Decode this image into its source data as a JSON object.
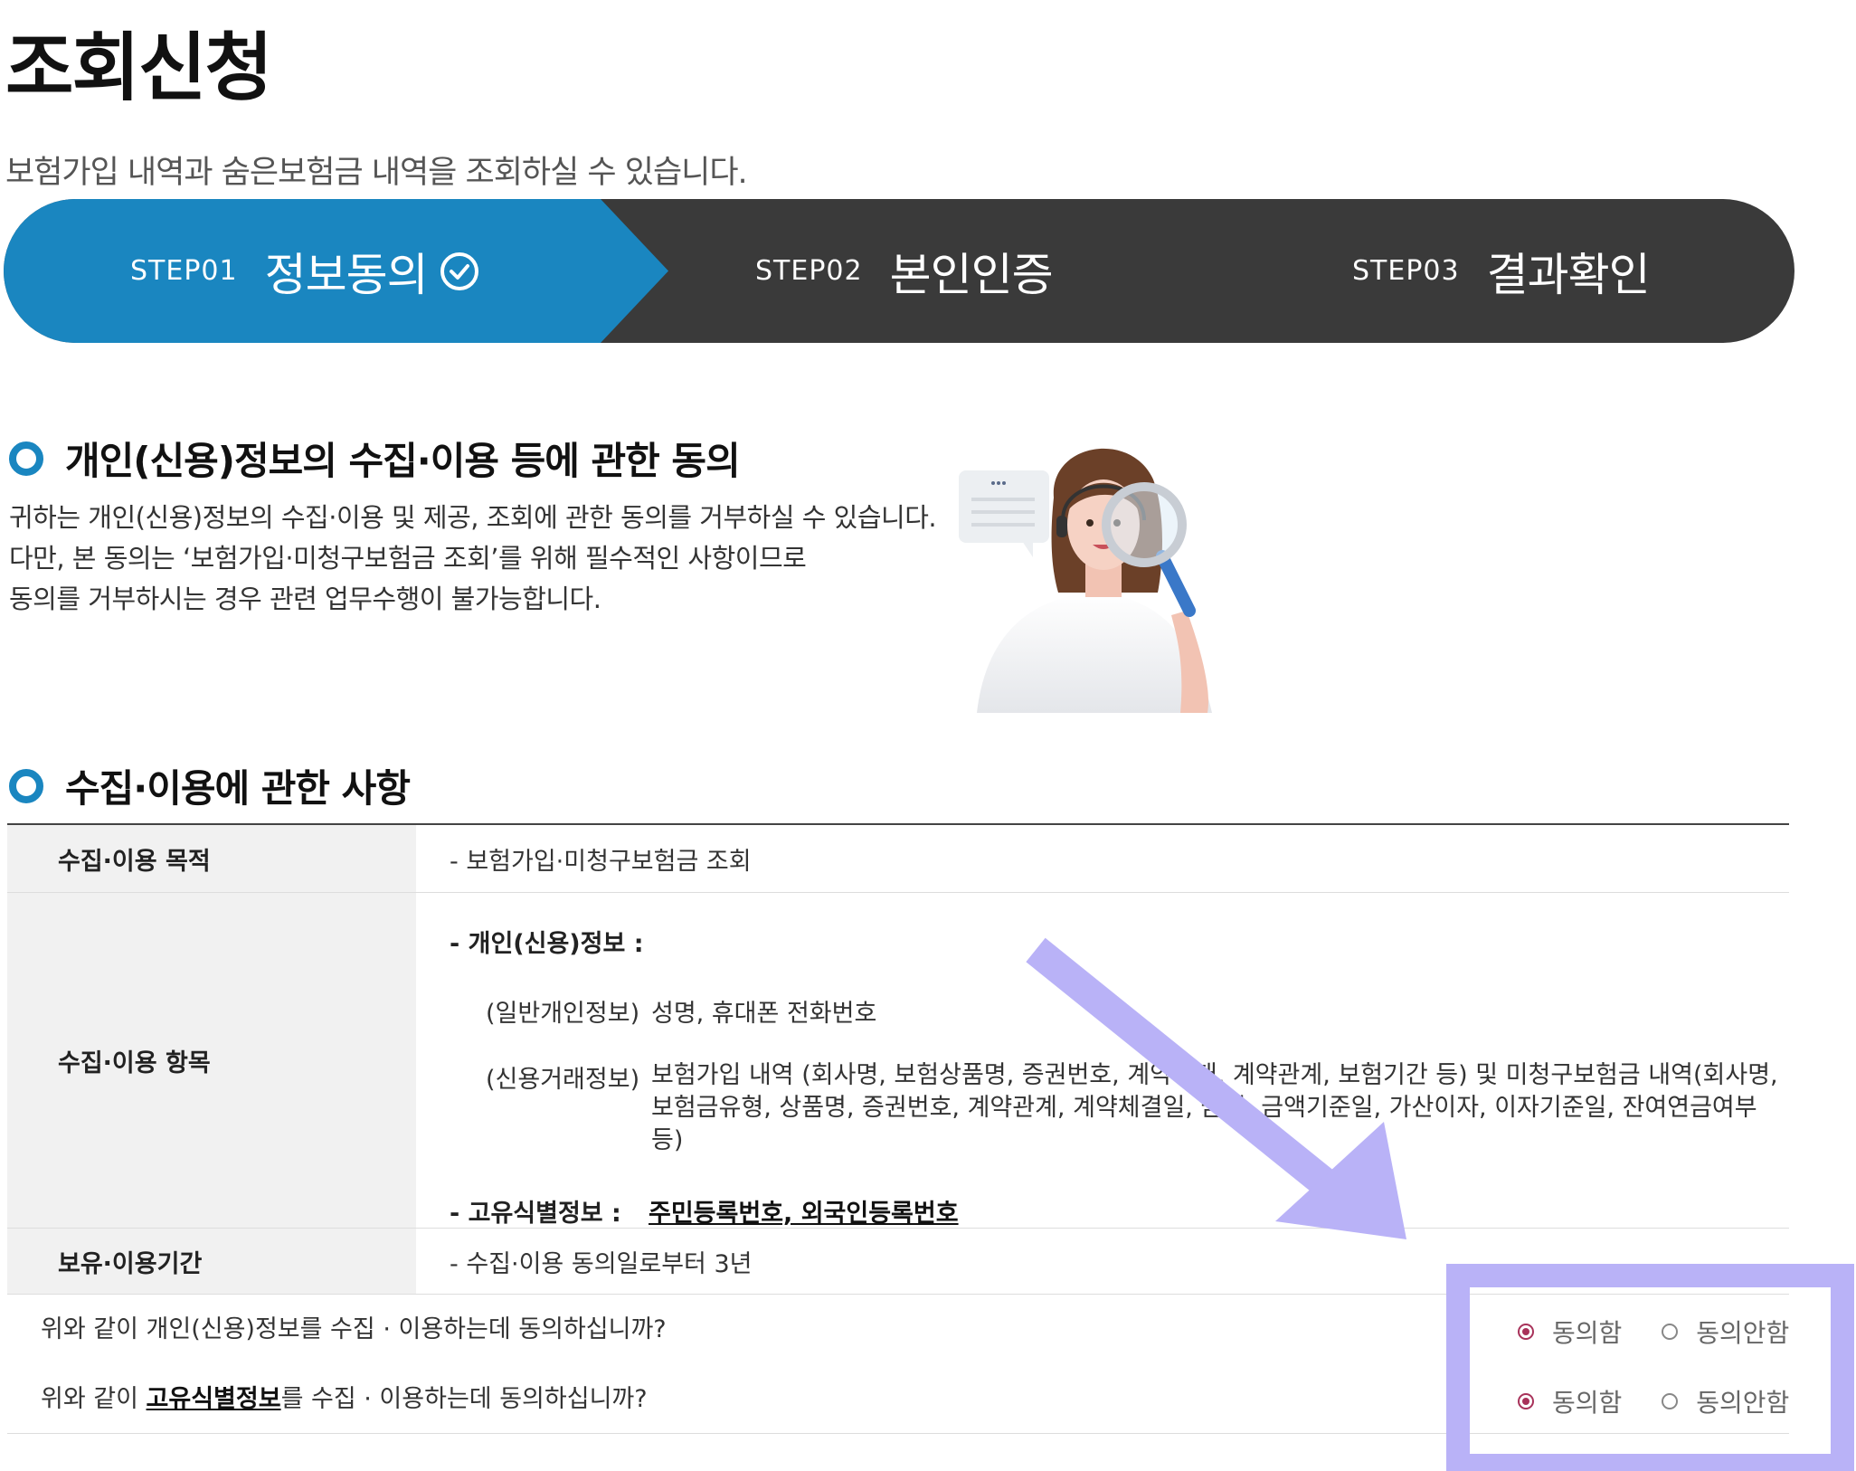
{
  "page": {
    "title": "조회신청",
    "subtitle": "보험가입 내역과 숨은보험금 내역을 조회하실 수 있습니다."
  },
  "steps": [
    {
      "no": "STEP01",
      "label": "정보동의",
      "active": true,
      "icon": "check-circle-icon"
    },
    {
      "no": "STEP02",
      "label": "본인인증",
      "active": false
    },
    {
      "no": "STEP03",
      "label": "결과확인",
      "active": false
    }
  ],
  "consent_section": {
    "title": "개인(신용)정보의 수집·이용 등에 관한 동의",
    "lines": [
      "귀하는 개인(신용)정보의 수집·이용 및 제공, 조회에 관한 동의를 거부하실 수 있습니다.",
      "다만, 본 동의는 ‘보험가입·미청구보험금 조회’를 위해 필수적인 사항이므로",
      "동의를 거부하시는 경우 관련 업무수행이 불가능합니다."
    ],
    "illustration": "consultant-with-magnifier-illustration"
  },
  "collection_section": {
    "title": "수집·이용에 관한 사항",
    "purpose": {
      "head": "수집·이용 목적",
      "value": "- 보험가입·미청구보험금 조회"
    },
    "items": {
      "head": "수집·이용 항목",
      "personal_label": "- 개인(신용)정보 :",
      "general_tag": "(일반개인정보)",
      "general_value": "성명, 휴대폰 전화번호",
      "credit_tag": "(신용거래정보)",
      "credit_value_1": "보험가입 내역 (회사명, 보험상품명, 증권번호, 계약상태, 계약관계, 보험기간 등) 및 미청구보험금 내역(회사명,",
      "credit_value_2": "보험금유형, 상품명, 증권번호, 계약관계, 계약체결일, 금액, 금액기준일, 가산이자, 이자기준일, 잔여연금여부 등)",
      "uid_label": "- 고유식별정보 :",
      "uid_value": "주민등록번호, 외국인등록번호"
    },
    "retention": {
      "head": "보유·이용기간",
      "value": "- 수집·이용 동의일로부터 3년"
    }
  },
  "questions": [
    {
      "prefix": "위와 같이 개인(신용)정보를 수집 · 이용하는데 동의하십니까?",
      "emphasis": "",
      "suffix": "",
      "agree": "동의함",
      "disagree": "동의안함",
      "selected": "agree"
    },
    {
      "prefix": "위와 같이 ",
      "emphasis": "고유식별정보",
      "suffix": "를 수집 · 이용하는데 동의하십니까?",
      "agree": "동의함",
      "disagree": "동의안함",
      "selected": "agree"
    }
  ],
  "colors": {
    "step_active": "#1a86c0",
    "step_inactive": "#3a3a3a",
    "radio_checked": "#a8325a",
    "annotation": "#b9b2f7"
  }
}
